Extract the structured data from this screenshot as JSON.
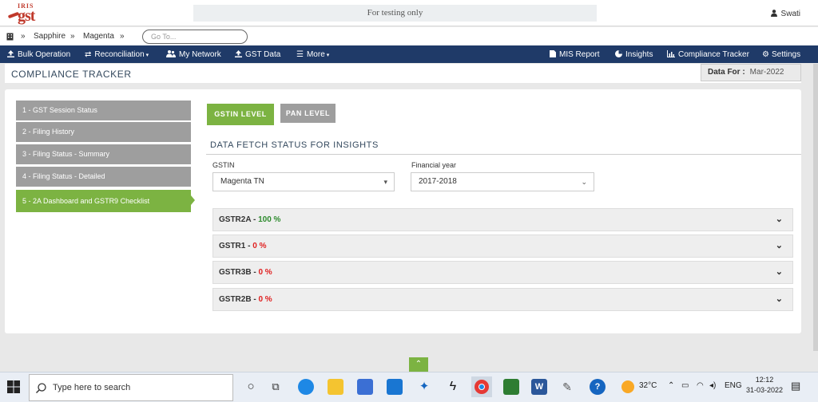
{
  "header": {
    "logo_text_top": "IRIS",
    "logo_text_main": "gst",
    "banner": "For testing only",
    "user": "Swati"
  },
  "breadcrumb": {
    "items": [
      "Sapphire",
      "Magenta"
    ],
    "separator": "»",
    "goto_placeholder": "Go To..."
  },
  "nav": {
    "left": [
      {
        "label": "Bulk Operation",
        "icon": "upload-icon"
      },
      {
        "label": "Reconciliation",
        "icon": "exchange-icon",
        "dropdown": true
      },
      {
        "label": "My Network",
        "icon": "users-icon"
      },
      {
        "label": "GST Data",
        "icon": "upload-icon"
      },
      {
        "label": "More",
        "icon": "menu-icon",
        "dropdown": true
      }
    ],
    "right": [
      {
        "label": "MIS Report",
        "icon": "file-icon"
      },
      {
        "label": "Insights",
        "icon": "pie-icon"
      },
      {
        "label": "Compliance Tracker",
        "icon": "bar-chart-icon"
      },
      {
        "label": "Settings",
        "icon": "gear-icon"
      }
    ]
  },
  "page": {
    "title": "COMPLIANCE TRACKER",
    "data_for_label": "Data For :",
    "data_for_value": "Mar-2022"
  },
  "sidebar": {
    "items": [
      {
        "label": "1 - GST Session Status",
        "active": false
      },
      {
        "label": "2 - Filing History",
        "active": false
      },
      {
        "label": "3 - Filing Status - Summary",
        "active": false
      },
      {
        "label": "4 - Filing Status - Detailed",
        "active": false
      },
      {
        "label": "5 - 2A Dashboard and GSTR9 Checklist",
        "active": true
      }
    ]
  },
  "tabs": [
    {
      "label": "GSTIN LEVEL",
      "active": true
    },
    {
      "label": "PAN LEVEL",
      "active": false
    }
  ],
  "section_title": "DATA FETCH STATUS FOR INSIGHTS",
  "filters": {
    "gstin_label": "GSTIN",
    "gstin_value": "Magenta TN",
    "fy_label": "Financial year",
    "fy_value": "2017-2018"
  },
  "accordions": [
    {
      "name": "GSTR2A - ",
      "percent": "100 %",
      "status": "green"
    },
    {
      "name": "GSTR1 - ",
      "percent": "0 %",
      "status": "red"
    },
    {
      "name": "GSTR3B - ",
      "percent": "0 %",
      "status": "red"
    },
    {
      "name": "GSTR2B - ",
      "percent": "0 %",
      "status": "red"
    }
  ],
  "taskbar": {
    "search_placeholder": "Type here to search",
    "weather": "32°C",
    "language": "ENG",
    "time": "12:12",
    "date": "31-03-2022"
  },
  "colors": {
    "nav_bg": "#1f3a68",
    "accent_green": "#7cb342",
    "sidebar_grey": "#9e9e9e",
    "success": "#2e8b2e",
    "danger": "#e02020"
  }
}
